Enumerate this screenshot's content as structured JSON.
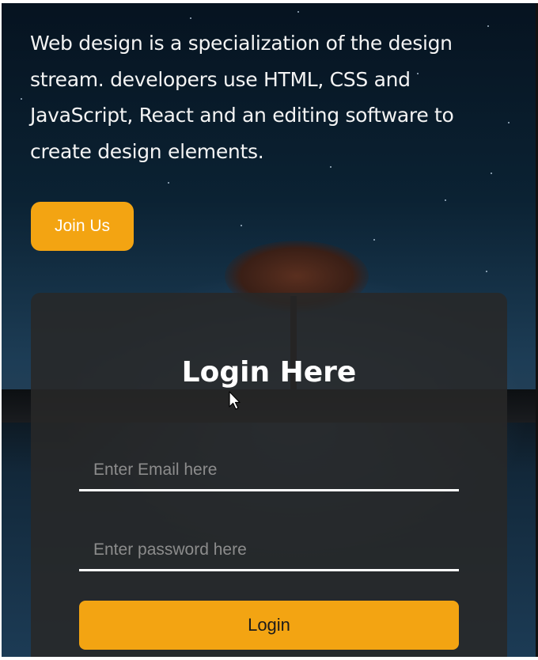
{
  "intro": {
    "text": "Web design is a specialization of the design stream. developers use HTML, CSS and JavaScript, React and an editing software to create design elements."
  },
  "join_button": {
    "label": "Join Us"
  },
  "login_card": {
    "title": "Login Here",
    "email": {
      "placeholder": "Enter Email here",
      "value": ""
    },
    "password": {
      "placeholder": "Enter password here",
      "value": ""
    },
    "submit_label": "Login"
  },
  "colors": {
    "accent": "#f3a412",
    "card_bg": "#282828",
    "text": "#f4f4f4"
  },
  "icons": {
    "cursor": "mouse-pointer-icon"
  }
}
